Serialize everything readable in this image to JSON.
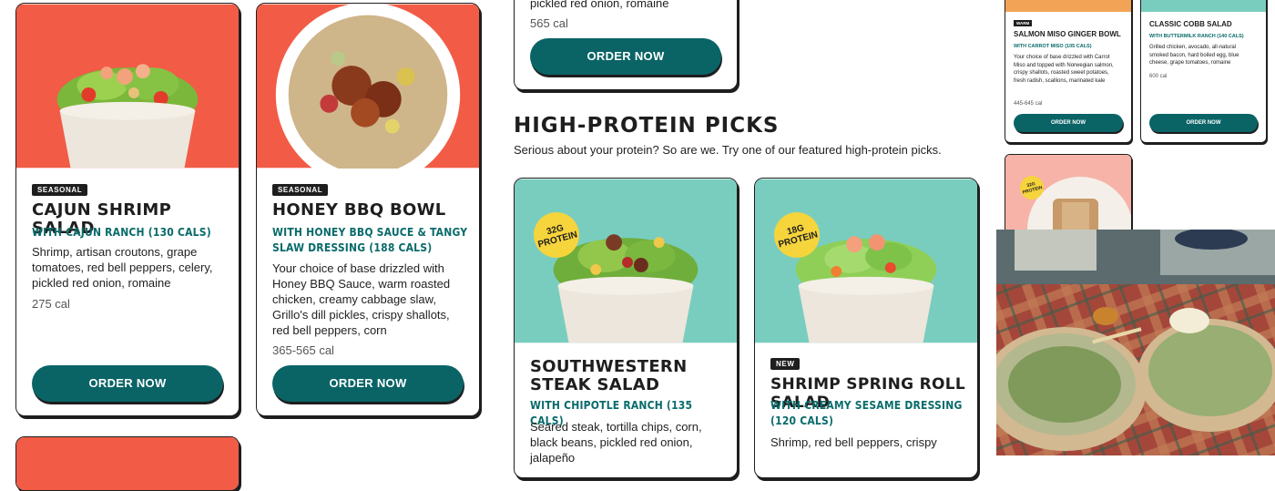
{
  "colors": {
    "accent_teal": "#0a6466",
    "subtitle_teal": "#0a6b6b",
    "coral_bg": "#f25b45",
    "mint_bg": "#79cdbf",
    "protein_badge": "#f6d43c",
    "pink_bg": "#f7b3a8"
  },
  "cards": [
    {
      "badge": "SEASONAL",
      "title": "CAJUN SHRIMP SALAD",
      "subtitle": "WITH CAJUN RANCH (130 CALS)",
      "description": "Shrimp, artisan croutons, grape tomatoes, red bell peppers, celery, pickled red onion, romaine",
      "calories": "275 cal",
      "button": "ORDER NOW"
    },
    {
      "badge": "SEASONAL",
      "title": "HONEY BBQ BOWL",
      "subtitle": "WITH HONEY BBQ SAUCE & TANGY SLAW DRESSING (188 CALS)",
      "description": "Your choice of base drizzled with Honey BBQ Sauce, warm roasted chicken, creamy cabbage slaw, Grillo's dill pickles, crispy shallots, red bell peppers, corn",
      "calories": "365-565 cal",
      "button": "ORDER NOW"
    }
  ],
  "partial_card_top": {
    "description_tail": "pickled red onion, romaine",
    "calories": "565 cal",
    "button": "ORDER NOW"
  },
  "section": {
    "title": "HIGH-PROTEIN PICKS",
    "subtitle": "Serious about your protein? So are we. Try one of our featured high-protein picks."
  },
  "protein_cards": [
    {
      "protein": "32G PROTEIN",
      "title": "SOUTHWESTERN STEAK SALAD",
      "subtitle": "WITH CHIPOTLE RANCH (135 CALS)",
      "description": "Seared steak, tortilla chips, corn, black beans, pickled red onion, jalapeño"
    },
    {
      "protein": "18G PROTEIN",
      "badge": "NEW",
      "title": "SHRIMP SPRING ROLL SALAD",
      "subtitle": "WITH CREAMY SESAME DRESSING (120 CALS)",
      "description": "Shrimp, red bell peppers, crispy"
    }
  ],
  "mini_cards": [
    {
      "badge": "WARM",
      "title": "SALMON MISO GINGER BOWL",
      "subtitle": "WITH CARROT MISO (105 CALS)",
      "description": "Your choice of base drizzled with Carrot Miso and topped with Norwegian salmon, crispy shallots, roasted sweet potatoes, fresh radish, scallions, marinated kale",
      "calories": "445-645 cal",
      "button": "ORDER NOW"
    },
    {
      "title": "CLASSIC COBB SALAD",
      "subtitle": "WITH BUTTERMILK RANCH (140 CALS)",
      "description": "Grilled chicken, avocado, all-natural smoked bacon, hard boiled egg, blue cheese, grape tomatoes, romaine",
      "calories": "600 cal",
      "button": "ORDER NOW"
    },
    {
      "protein": "32G PROTEIN"
    }
  ],
  "icons": {
    "bowl": "salad-bowl-icon"
  }
}
